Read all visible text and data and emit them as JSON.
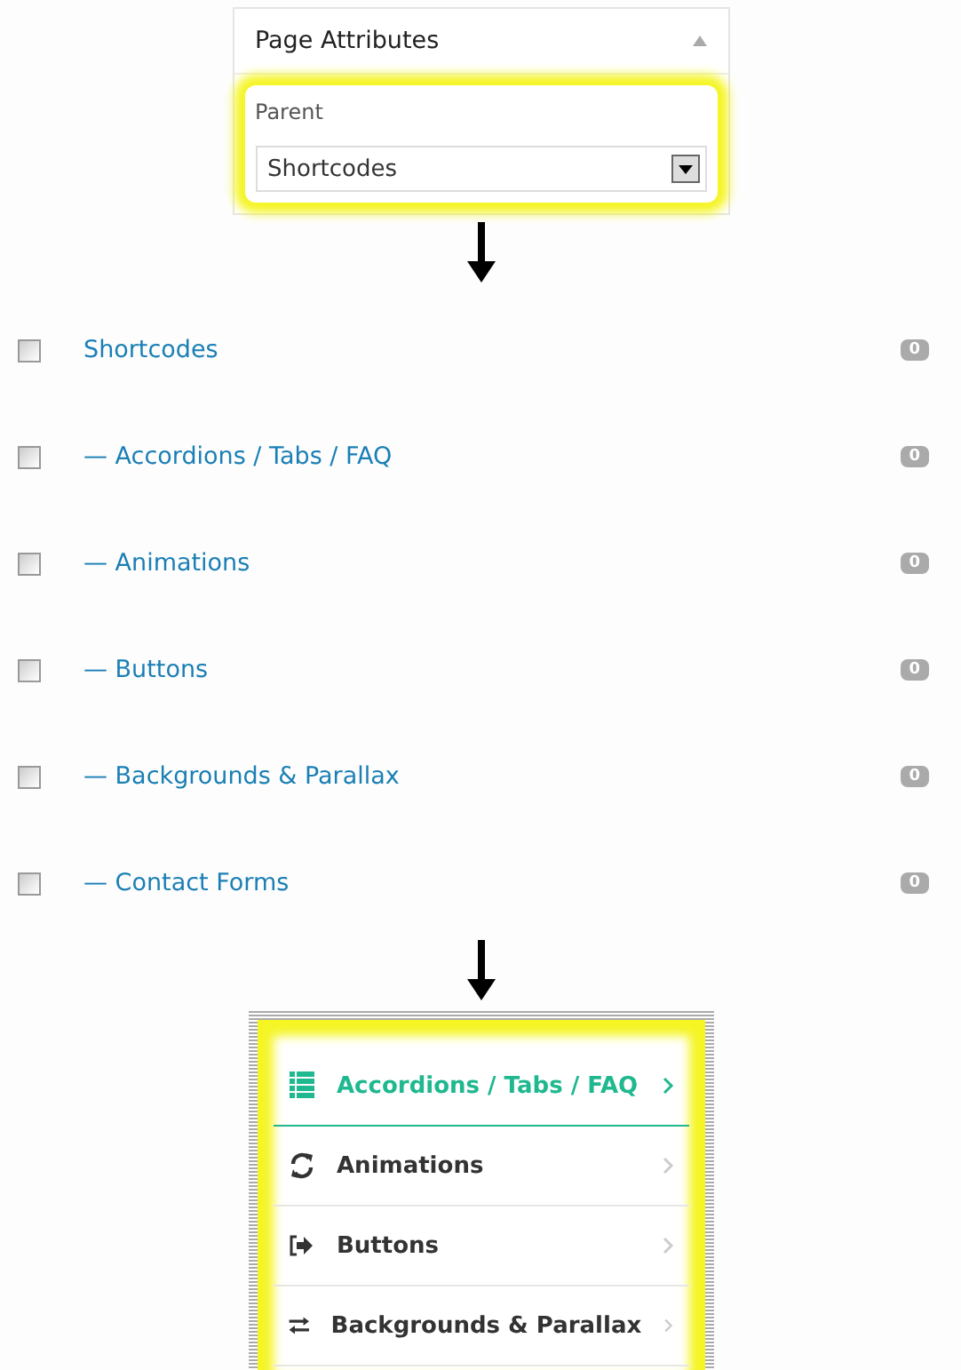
{
  "page_attributes": {
    "title": "Page Attributes",
    "expanded": true,
    "parent_label": "Parent",
    "parent_value": "Shortcodes"
  },
  "pages": [
    {
      "title": "Shortcodes",
      "checked": false,
      "comments": "0"
    },
    {
      "title": "— Accordions / Tabs / FAQ",
      "checked": false,
      "comments": "0"
    },
    {
      "title": "— Animations",
      "checked": false,
      "comments": "0"
    },
    {
      "title": "— Buttons",
      "checked": false,
      "comments": "0"
    },
    {
      "title": "— Backgrounds & Parallax",
      "checked": false,
      "comments": "0"
    },
    {
      "title": "— Contact Forms",
      "checked": false,
      "comments": "0"
    }
  ],
  "menu": [
    {
      "label": "Accordions / Tabs / FAQ",
      "selected": true
    },
    {
      "label": "Animations",
      "selected": false
    },
    {
      "label": "Buttons",
      "selected": false
    },
    {
      "label": "Backgrounds & Parallax",
      "selected": false
    }
  ]
}
